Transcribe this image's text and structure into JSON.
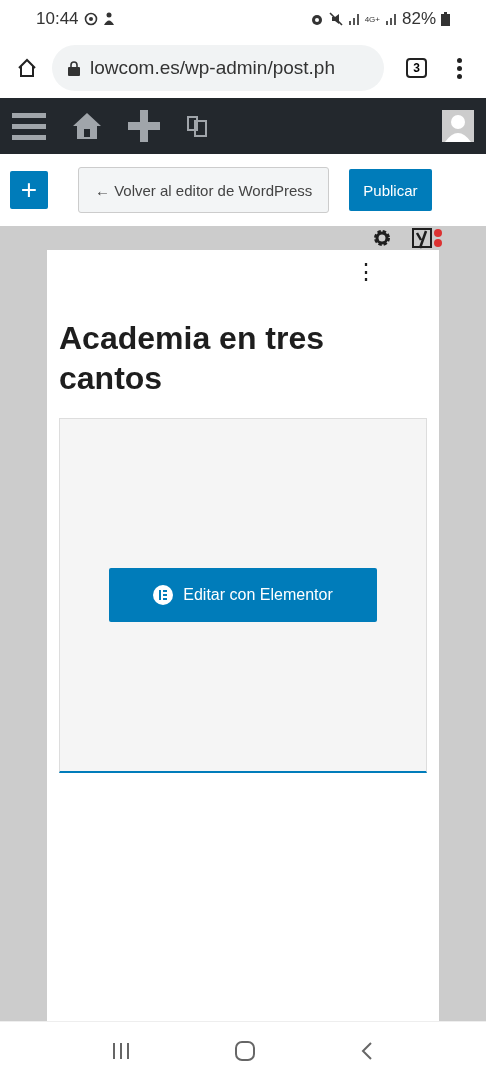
{
  "status_bar": {
    "time": "10:44",
    "network": "4G+",
    "battery": "82%"
  },
  "browser": {
    "url": "lowcom.es/wp-admin/post.ph",
    "tab_count": "3"
  },
  "toolbar": {
    "back_button": "← Volver al editor de WordPress",
    "publish_button": "Publicar",
    "add_button": "+"
  },
  "post": {
    "title": "Academia en tres cantos",
    "menu": "⋮"
  },
  "elementor": {
    "button": "Editar con Elementor"
  }
}
